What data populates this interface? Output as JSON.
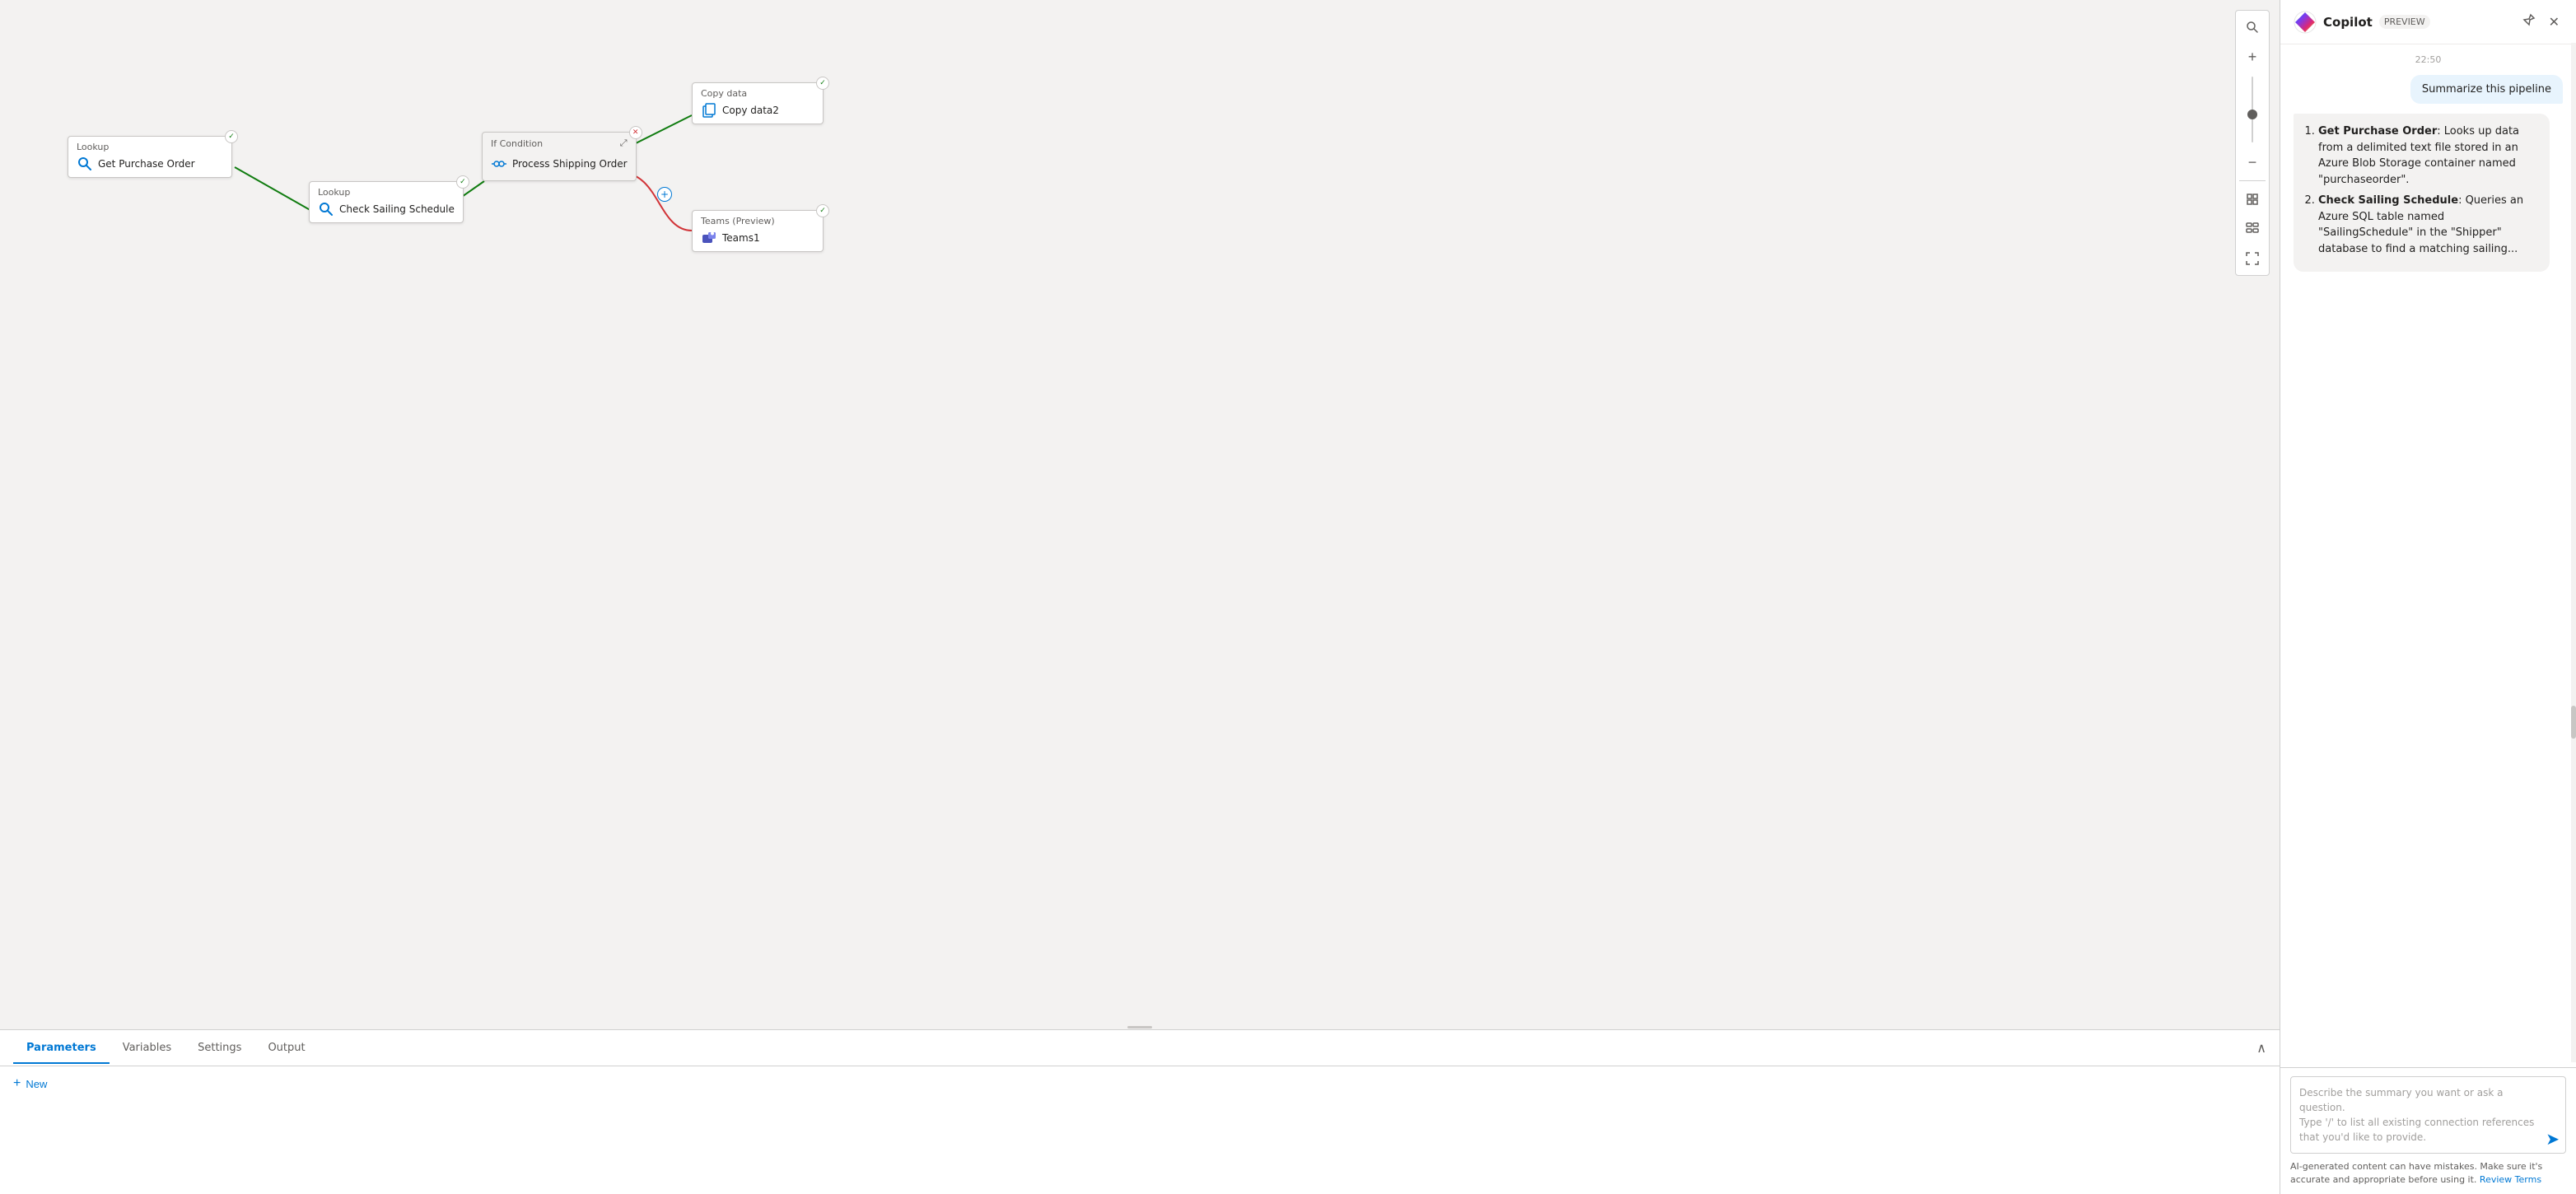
{
  "canvas": {
    "nodes": {
      "lookup1": {
        "header": "Lookup",
        "label": "Get Purchase Order",
        "type": "lookup",
        "hasCheck": true
      },
      "lookup2": {
        "header": "Lookup",
        "label": "Check Sailing Schedule",
        "type": "lookup",
        "hasCheck": true
      },
      "ifCondition": {
        "header": "If Condition",
        "type": "if"
      },
      "processShipping": {
        "label": "Process Shipping Order",
        "type": "process",
        "hasX": true
      },
      "copyData": {
        "header": "Copy data",
        "label": "Copy data2",
        "type": "copy",
        "hasCheck": true
      },
      "teams": {
        "header": "Teams (Preview)",
        "label": "Teams1",
        "type": "teams",
        "hasCheck": true
      }
    },
    "toolbar": {
      "searchTitle": "Search",
      "zoomInLabel": "+",
      "zoomOutLabel": "−"
    }
  },
  "bottomPanel": {
    "tabs": [
      {
        "label": "Parameters",
        "active": true
      },
      {
        "label": "Variables",
        "active": false
      },
      {
        "label": "Settings",
        "active": false
      },
      {
        "label": "Output",
        "active": false
      }
    ],
    "newButtonLabel": "New"
  },
  "copilot": {
    "title": "Copilot",
    "previewBadge": "PREVIEW",
    "timestamp": "22:50",
    "userMessage": "Summarize this pipeline",
    "aiResponse": {
      "intro": "",
      "items": [
        {
          "name": "Get Purchase Order",
          "desc": ": Looks up data from a delimited text file stored in an Azure Blob Storage container named \"purchaseorder\"."
        },
        {
          "name": "Check Sailing Schedule",
          "desc": ": Queries an Azure SQL table named \"SailingSchedule\" in the \"Shipper\" database to find a matching sailing..."
        }
      ]
    },
    "inputPlaceholder": "Describe the summary you want or ask a question.\nType '/' to list all existing connection references that you'd like to provide.",
    "disclaimer": "AI-generated content can have mistakes. Make sure it's accurate and appropriate before using it.",
    "reviewTermsLabel": "Review Terms"
  }
}
